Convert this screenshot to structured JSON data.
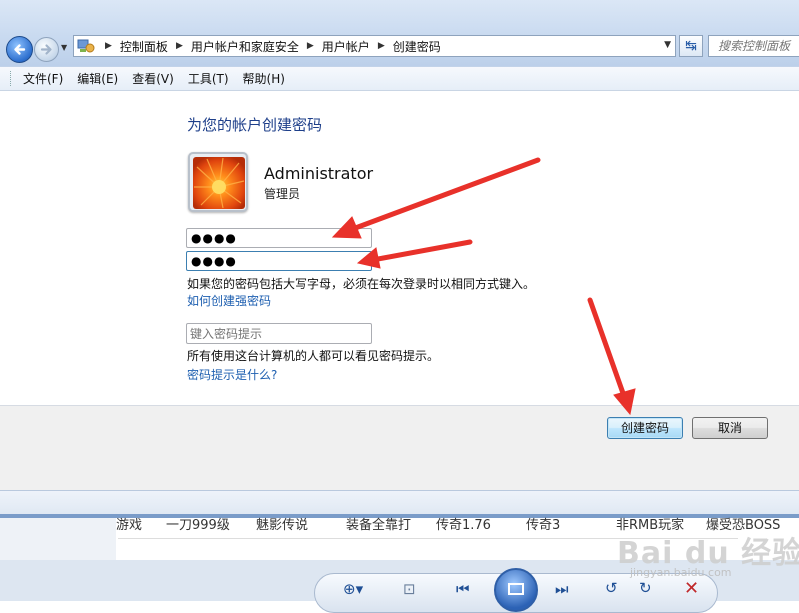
{
  "address_bar": {
    "breadcrumbs": [
      "控制面板",
      "用户帐户和家庭安全",
      "用户帐户",
      "创建密码"
    ],
    "search_placeholder": "搜索控制面板"
  },
  "menu": [
    "文件(F)",
    "编辑(E)",
    "查看(V)",
    "工具(T)",
    "帮助(H)"
  ],
  "content": {
    "title": "为您的帐户创建密码",
    "user_name": "Administrator",
    "user_role": "管理员",
    "new_password_value": "●●●●",
    "confirm_password_value": "●●●●",
    "caps_note": "如果您的密码包括大写字母，必须在每次登录时以相同方式键入。",
    "strong_password_link": "如何创建强密码",
    "hint_placeholder": "键入密码提示",
    "hint_note": "所有使用这台计算机的人都可以看见密码提示。",
    "hint_link": "密码提示是什么?"
  },
  "buttons": {
    "create": "创建密码",
    "cancel": "取消"
  },
  "background_page_row": [
    "游戏",
    "一刀999级",
    "魅影传说",
    "装备全靠打",
    "传奇1.76",
    "传奇3",
    "非RMB玩家",
    "爆受恐BOSS"
  ],
  "watermark": {
    "logo_text": "Bai du 经验",
    "url": "jingyan.baidu.com"
  },
  "colors": {
    "title_blue": "#1e3f8a",
    "link_blue": "#1e5fb0",
    "arrow_red": "#e8312a"
  },
  "icons": [
    "back-icon",
    "forward-icon",
    "control-panel-icon",
    "refresh-icon",
    "user-flower-picture",
    "zoom-icon",
    "fit-icon",
    "previous-icon",
    "slideshow-icon",
    "next-icon",
    "rotate-left-icon",
    "rotate-right-icon",
    "delete-icon"
  ]
}
